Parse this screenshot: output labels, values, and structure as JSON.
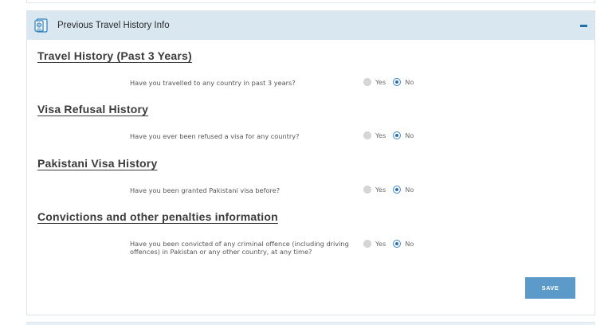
{
  "panel": {
    "title": "Previous Travel History Info",
    "icon": "passport-icon",
    "collapse_icon": "minus-icon"
  },
  "sections": [
    {
      "title": "Travel History (Past 3 Years)",
      "question": "Have you travelled to any country in past 3 years?",
      "options": [
        "Yes",
        "No"
      ],
      "selected": "No"
    },
    {
      "title": "Visa Refusal History",
      "question": "Have you ever been refused a visa for any country?",
      "options": [
        "Yes",
        "No"
      ],
      "selected": "No"
    },
    {
      "title": "Pakistani Visa History",
      "question": "Have you been granted Pakistani visa before?",
      "options": [
        "Yes",
        "No"
      ],
      "selected": "No"
    },
    {
      "title": "Convictions and other penalties information",
      "question": "Have you been convicted of any criminal offence (including driving offences) in Pakistan or any other country, at any time?",
      "options": [
        "Yes",
        "No"
      ],
      "selected": "No"
    }
  ],
  "save_label": "SAVE",
  "colors": {
    "header_bg": "#d8e7f0",
    "accent": "#1f6fa8",
    "save_bg": "#5b9ac9"
  }
}
